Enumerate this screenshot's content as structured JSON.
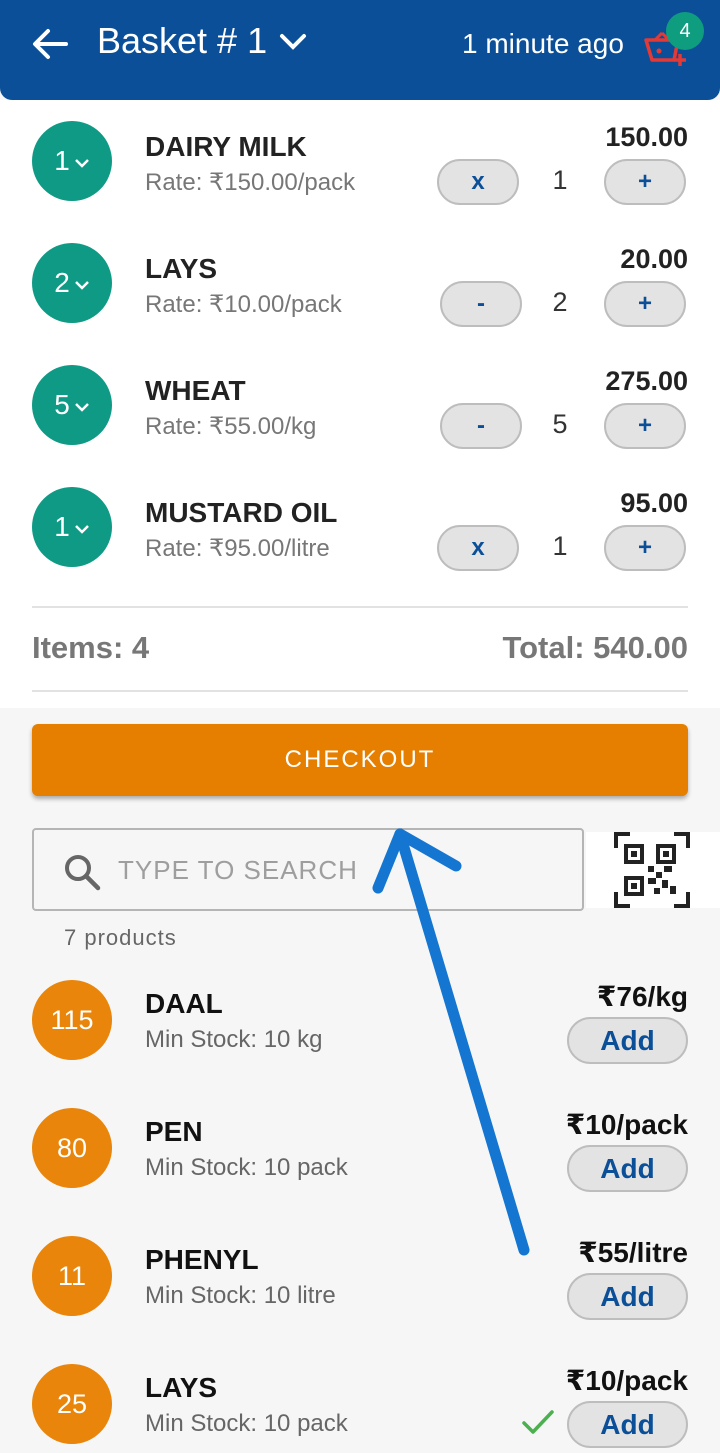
{
  "header": {
    "title": "Basket # 1",
    "time": "1 minute ago",
    "cart_count": "4",
    "back_icon": "arrow-left-icon",
    "cart_icon": "basket-add-icon"
  },
  "basket_items": [
    {
      "qty": "1",
      "name": "DAIRY MILK",
      "rate": "Rate: ₹150.00/pack",
      "price": "150.00",
      "minus": "x",
      "count": "1",
      "plus": "+"
    },
    {
      "qty": "2",
      "name": "LAYS",
      "rate": "Rate: ₹10.00/pack",
      "price": "20.00",
      "minus": "-",
      "count": "2",
      "plus": "+"
    },
    {
      "qty": "5",
      "name": "WHEAT",
      "rate": "Rate: ₹55.00/kg",
      "price": "275.00",
      "minus": "-",
      "count": "5",
      "plus": "+"
    },
    {
      "qty": "1",
      "name": "MUSTARD OIL",
      "rate": "Rate: ₹95.00/litre",
      "price": "95.00",
      "minus": "x",
      "count": "1",
      "plus": "+"
    }
  ],
  "summary": {
    "items": "Items: 4",
    "total": "Total: 540.00"
  },
  "checkout_label": "CHECKOUT",
  "search": {
    "placeholder": "TYPE TO SEARCH",
    "value": ""
  },
  "product_count": "7 products",
  "products": [
    {
      "stock": "115",
      "name": "DAAL",
      "min": "Min Stock: 10 kg",
      "price": "₹76/kg",
      "add": "Add"
    },
    {
      "stock": "80",
      "name": "PEN",
      "min": "Min Stock: 10 pack",
      "price": "₹10/pack",
      "add": "Add"
    },
    {
      "stock": "11",
      "name": "PHENYL",
      "min": "Min Stock: 10 litre",
      "price": "₹55/litre",
      "add": "Add"
    },
    {
      "stock": "25",
      "name": "LAYS",
      "min": "Min Stock: 10 pack",
      "price": "₹10/pack",
      "add": "Add"
    }
  ],
  "colors": {
    "header": "#0b4f98",
    "qty_circle": "#0f9a85",
    "stock_circle": "#e8850a",
    "checkout": "#e67f00",
    "annotation_arrow": "#1576d1"
  }
}
